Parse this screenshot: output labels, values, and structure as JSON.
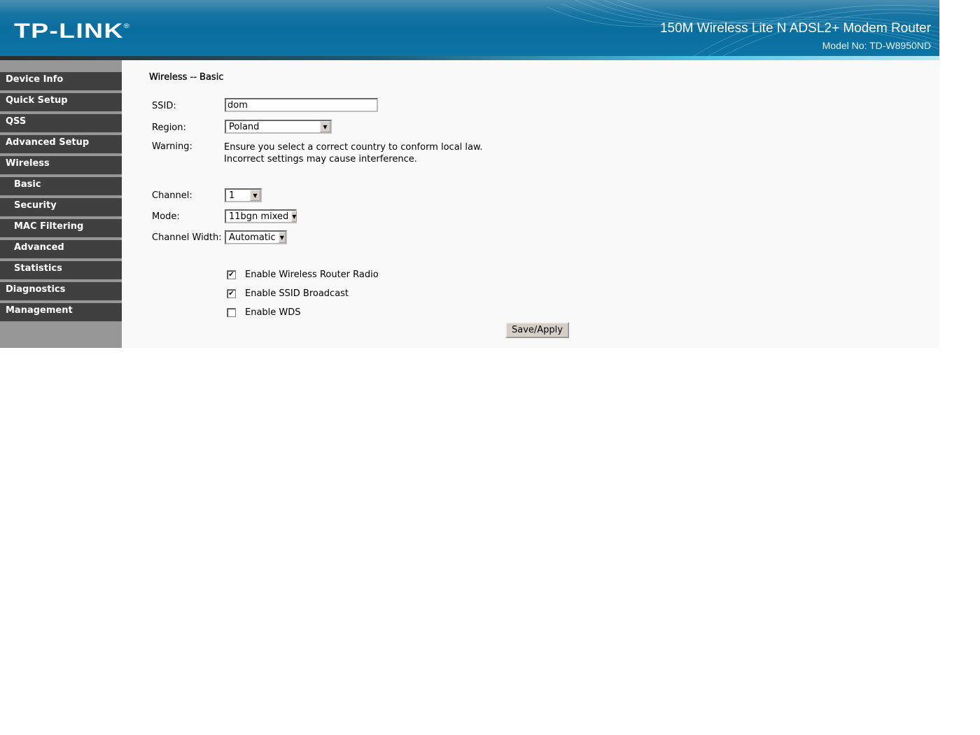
{
  "header": {
    "logo": "TP-LINK",
    "logo_mark": "®",
    "product_name": "150M Wireless Lite N ADSL2+ Modem Router",
    "model": "Model No: TD-W8950ND"
  },
  "sidebar": {
    "items": [
      {
        "label": "Device Info",
        "sub": false
      },
      {
        "label": "Quick Setup",
        "sub": false
      },
      {
        "label": "QSS",
        "sub": false
      },
      {
        "label": "Advanced Setup",
        "sub": false
      },
      {
        "label": "Wireless",
        "sub": false
      },
      {
        "label": "Basic",
        "sub": true
      },
      {
        "label": "Security",
        "sub": true
      },
      {
        "label": "MAC Filtering",
        "sub": true
      },
      {
        "label": "Advanced",
        "sub": true
      },
      {
        "label": "Statistics",
        "sub": true
      },
      {
        "label": "Diagnostics",
        "sub": false
      },
      {
        "label": "Management",
        "sub": false
      }
    ]
  },
  "main": {
    "title": "Wireless -- Basic",
    "ssid": {
      "label": "SSID:",
      "value": "dom"
    },
    "region": {
      "label": "Region:",
      "value": "Poland"
    },
    "warning": {
      "label": "Warning:",
      "line1": "Ensure you select a correct country to conform local law.",
      "line2": "Incorrect settings may cause interference."
    },
    "channel": {
      "label": "Channel:",
      "value": "1"
    },
    "mode": {
      "label": "Mode:",
      "value": "11bgn mixed"
    },
    "channel_width": {
      "label": "Channel Width:",
      "value": "Automatic"
    },
    "checkboxes": [
      {
        "label": "Enable Wireless Router Radio",
        "checked": true
      },
      {
        "label": "Enable SSID Broadcast",
        "checked": true
      },
      {
        "label": "Enable WDS",
        "checked": false
      }
    ],
    "save_label": "Save/Apply"
  },
  "icons": {
    "dropdown_arrow": "▼",
    "check_mark": "✔"
  }
}
